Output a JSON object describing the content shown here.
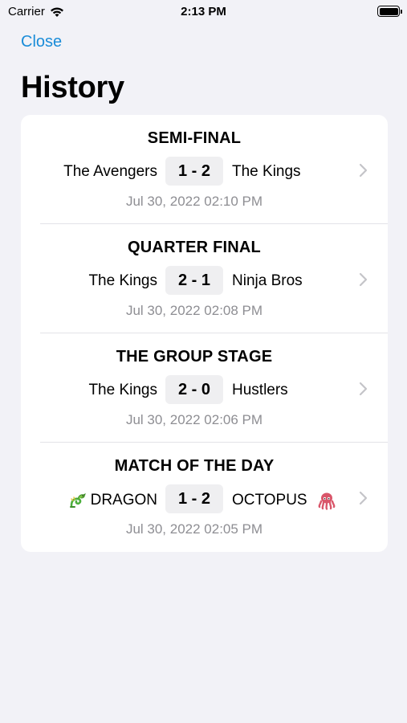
{
  "status_bar": {
    "carrier": "Carrier",
    "time": "2:13 PM"
  },
  "nav": {
    "close_label": "Close",
    "title": "History"
  },
  "matches": [
    {
      "round": "SEMI-FINAL",
      "home": "The Avengers",
      "away": "The Kings",
      "score": "1 - 2",
      "date": "Jul 30, 2022 02:10 PM"
    },
    {
      "round": "QUARTER FINAL",
      "home": "The Kings",
      "away": "Ninja Bros",
      "score": "2 - 1",
      "date": "Jul 30, 2022 02:08 PM"
    },
    {
      "round": "THE GROUP STAGE",
      "home": "The Kings",
      "away": "Hustlers",
      "score": "2 - 0",
      "date": "Jul 30, 2022 02:06 PM"
    },
    {
      "round": "MATCH OF THE DAY",
      "home": "DRAGON",
      "away": "OCTOPUS",
      "score": "1 - 2",
      "date": "Jul 30, 2022 02:05 PM",
      "home_icon": "dragon-icon",
      "away_icon": "octopus-icon"
    }
  ],
  "colors": {
    "accent": "#1a8cd8",
    "background": "#f2f2f7",
    "card": "#ffffff",
    "secondary_text": "#8e8e93",
    "score_bg": "#efeff1"
  }
}
